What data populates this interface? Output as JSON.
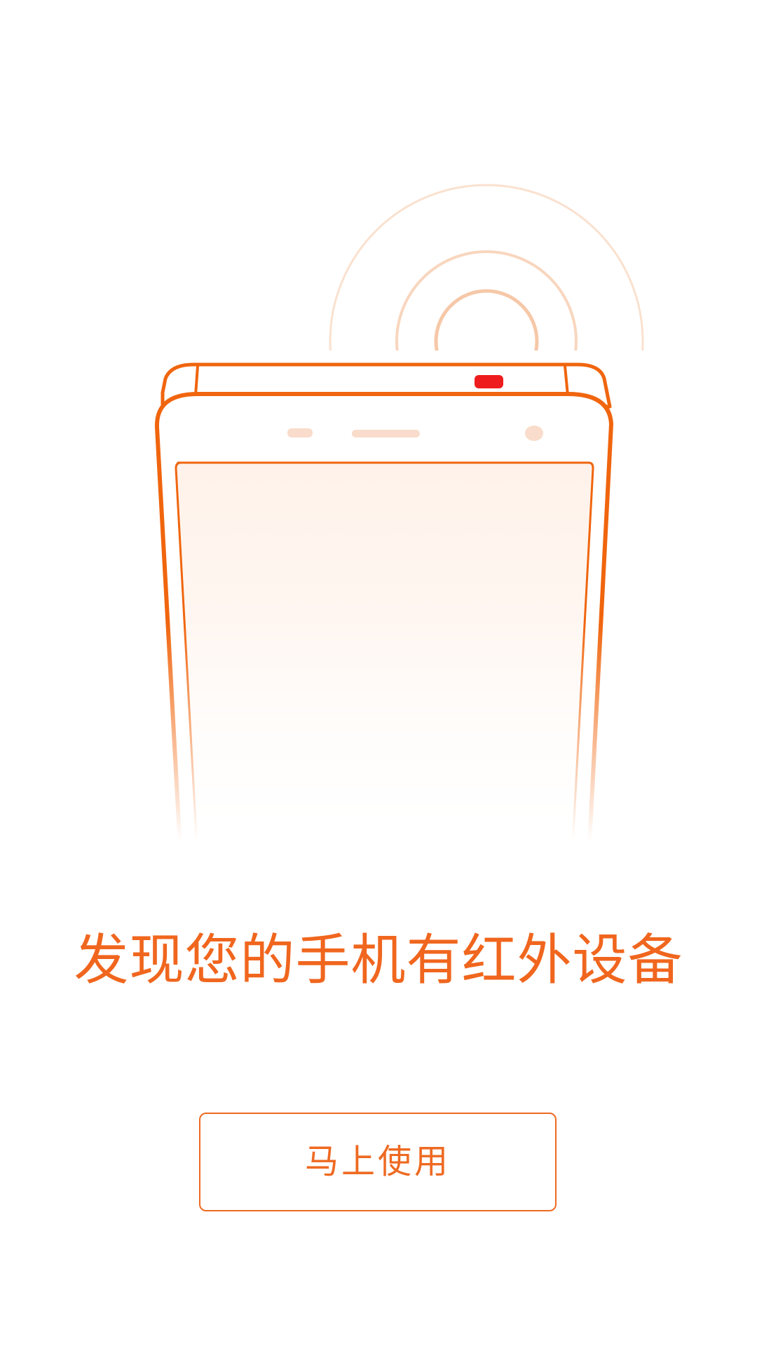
{
  "intro": {
    "headline": "发现您的手机有红外设备",
    "start_button_label": "马上使用"
  },
  "illustration": {
    "icon": "phone-infrared-icon",
    "colors": {
      "outline": "#f0650e",
      "ir_emitter": "#ee1c1c",
      "signal_waves": "#f6c8a8",
      "screen_fill": "#fff4ee"
    }
  }
}
